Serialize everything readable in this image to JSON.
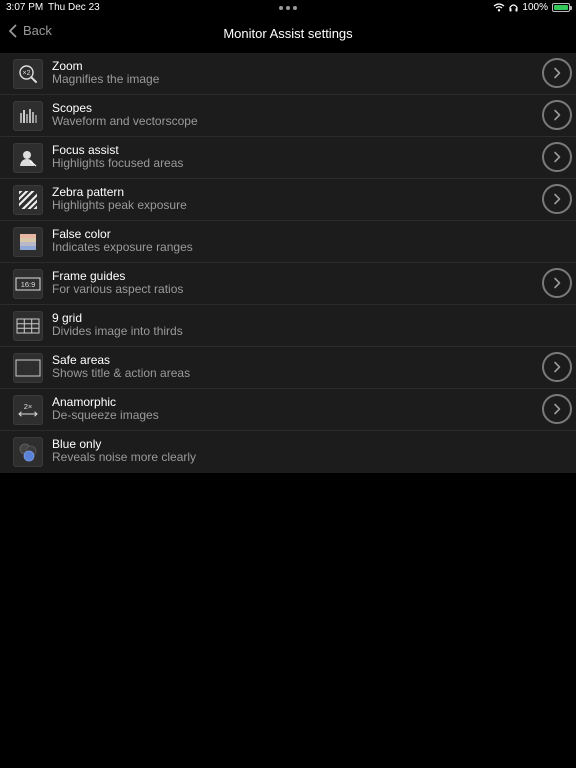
{
  "status_bar": {
    "time": "3:07 PM",
    "date": "Thu Dec 23",
    "battery": "100%"
  },
  "nav": {
    "back_label": "Back",
    "title": "Monitor Assist settings"
  },
  "colors": {
    "background": "#000000",
    "row_background": "#1c1c1c",
    "subtitle": "#9a9a9a",
    "battery_green": "#34c759"
  },
  "items": [
    {
      "icon": "zoom-icon",
      "icon_text": "×2",
      "title": "Zoom",
      "subtitle": "Magnifies the image",
      "has_chevron": true
    },
    {
      "icon": "scopes-icon",
      "title": "Scopes",
      "subtitle": "Waveform and vectorscope",
      "has_chevron": true
    },
    {
      "icon": "focus-assist-icon",
      "title": "Focus assist",
      "subtitle": "Highlights focused areas",
      "has_chevron": true
    },
    {
      "icon": "zebra-pattern-icon",
      "title": "Zebra pattern",
      "subtitle": "Highlights peak exposure",
      "has_chevron": true
    },
    {
      "icon": "false-color-icon",
      "title": "False color",
      "subtitle": "Indicates exposure ranges",
      "has_chevron": false
    },
    {
      "icon": "frame-guides-icon",
      "icon_text": "16:9",
      "title": "Frame guides",
      "subtitle": "For various aspect ratios",
      "has_chevron": true
    },
    {
      "icon": "grid-icon",
      "title": "9 grid",
      "subtitle": "Divides image into thirds",
      "has_chevron": false
    },
    {
      "icon": "safe-areas-icon",
      "title": "Safe areas",
      "subtitle": "Shows title & action areas",
      "has_chevron": true
    },
    {
      "icon": "anamorphic-icon",
      "icon_text": "2×",
      "title": "Anamorphic",
      "subtitle": "De-squeeze images",
      "has_chevron": true
    },
    {
      "icon": "blue-only-icon",
      "title": "Blue only",
      "subtitle": "Reveals noise more clearly",
      "has_chevron": false
    }
  ]
}
